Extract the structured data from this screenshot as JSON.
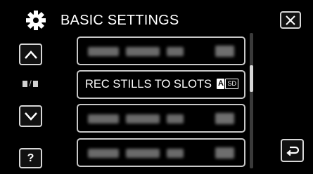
{
  "header": {
    "title": "BASIC SETTINGS"
  },
  "menu": {
    "items": [
      {
        "label": "",
        "blurred": true
      },
      {
        "label": "REC STILLS TO SLOTS",
        "blurred": false,
        "badges": [
          "A",
          "SD"
        ]
      },
      {
        "label": "",
        "blurred": true
      },
      {
        "label": "",
        "blurred": true
      }
    ]
  },
  "nav": {
    "page_indicator_sep": "/"
  },
  "help": {
    "label": "?"
  },
  "icons": {
    "settings": "gear-icon",
    "close": "close-icon",
    "up": "arrow-up-icon",
    "down": "arrow-down-icon",
    "back": "return-icon"
  },
  "colors": {
    "background": "#000000",
    "border": "#c8c8c8",
    "text": "#ffffff"
  }
}
